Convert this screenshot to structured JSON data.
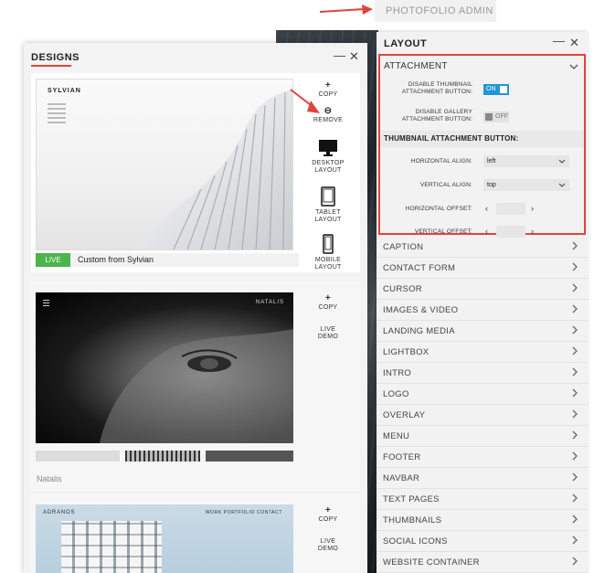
{
  "admin_tag": "PHOTOFOLIO ADMIN",
  "designs": {
    "title": "DESIGNS",
    "minimize": "—",
    "close": "✕",
    "cards": [
      {
        "logo": "SYLVIAN",
        "actions": [
          {
            "icon": "+",
            "label": "COPY"
          },
          {
            "icon": "⊖",
            "label": "REMOVE"
          },
          {
            "label1": "DESKTOP",
            "label2": "LAYOUT"
          },
          {
            "label1": "TABLET",
            "label2": "LAYOUT"
          },
          {
            "label1": "MOBILE",
            "label2": "LAYOUT"
          }
        ],
        "live_badge": "LIVE",
        "live_text": "Custom from Sylvian"
      },
      {
        "logo": "NATALIS",
        "actions": [
          {
            "icon": "+",
            "label": "COPY"
          },
          {
            "label1": "LIVE",
            "label2": "DEMO"
          }
        ],
        "name": "Natalis"
      },
      {
        "logo": "ADRANOS",
        "nav": "WORK   PORTFOLIO   CONTACT",
        "actions": [
          {
            "icon": "+",
            "label": "COPY"
          },
          {
            "label1": "LIVE",
            "label2": "DEMO"
          }
        ]
      }
    ]
  },
  "layout": {
    "title": "LAYOUT",
    "minimize": "—",
    "close": "✕",
    "attachment": {
      "heading": "ATTACHMENT",
      "disable_thumb_label1": "DISABLE THUMBNAIL",
      "disable_thumb_label2": "ATTACHMENT BUTTON:",
      "disable_thumb_state": "ON",
      "disable_gallery_label1": "DISABLE GALLERY",
      "disable_gallery_label2": "ATTACHMENT BUTTON:",
      "disable_gallery_state": "OFF",
      "subheading": "THUMBNAIL ATTACHMENT BUTTON:",
      "h_align_label": "HORIZONTAL ALIGN:",
      "h_align_value": "left",
      "v_align_label": "VERTICAL ALIGN:",
      "v_align_value": "top",
      "h_offset_label": "HORIZONTAL OFFSET:",
      "v_offset_label": "VERTICAL OFFSET:"
    },
    "sections": [
      "CAPTION",
      "CONTACT FORM",
      "CURSOR",
      "IMAGES & VIDEO",
      "LANDING MEDIA",
      "LIGHTBOX",
      "INTRO",
      "LOGO",
      "OVERLAY",
      "MENU",
      "FOOTER",
      "NAVBAR",
      "TEXT PAGES",
      "THUMBNAILS",
      "SOCIAL ICONS",
      "WEBSITE CONTAINER"
    ]
  },
  "colors": {
    "accent": "#e0443e",
    "live": "#4ab54a",
    "toggle_on": "#2196d3"
  }
}
